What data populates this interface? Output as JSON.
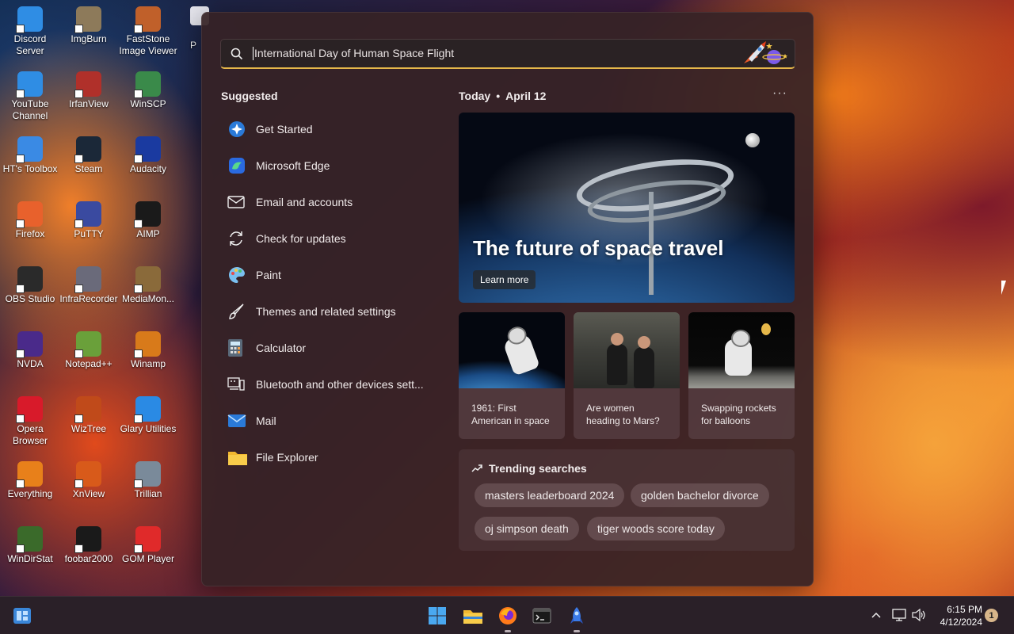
{
  "desktop": {
    "icons": [
      {
        "label": "Discord Server",
        "icon": "chrome-icon",
        "color": "#2f8de4"
      },
      {
        "label": "ImgBurn",
        "icon": "disc-icon",
        "color": "#8d7a5a"
      },
      {
        "label": "FastStone Image Viewer",
        "icon": "eye-icon",
        "color": "#c0602a"
      },
      {
        "label": "YouTube Channel",
        "icon": "chrome-icon",
        "color": "#2f8de4"
      },
      {
        "label": "IrfanView",
        "icon": "cat-icon",
        "color": "#b0302a"
      },
      {
        "label": "WinSCP",
        "icon": "computers-icon",
        "color": "#3a8a4a"
      },
      {
        "label": "HT's Toolbox",
        "icon": "folder-icon",
        "color": "#3a8ae4"
      },
      {
        "label": "Steam",
        "icon": "steam-icon",
        "color": "#1b2838"
      },
      {
        "label": "Audacity",
        "icon": "headphones-icon",
        "color": "#1a3aa0"
      },
      {
        "label": "Firefox",
        "icon": "firefox-icon",
        "color": "#e8612c"
      },
      {
        "label": "PuTTY",
        "icon": "terminal-icon",
        "color": "#3a4aa0"
      },
      {
        "label": "AIMP",
        "icon": "aimp-icon",
        "color": "#1a1a1a"
      },
      {
        "label": "OBS Studio",
        "icon": "obs-icon",
        "color": "#2a2a2a"
      },
      {
        "label": "InfraRecorder",
        "icon": "disc-icon",
        "color": "#6a6a7a"
      },
      {
        "label": "MediaMon...",
        "icon": "media-monkey-icon",
        "color": "#8a6a3a"
      },
      {
        "label": "NVDA",
        "icon": "nvda-icon",
        "color": "#4a2a8a"
      },
      {
        "label": "Notepad++",
        "icon": "notepad-icon",
        "color": "#6aa03a"
      },
      {
        "label": "Winamp",
        "icon": "winamp-icon",
        "color": "#d87a1a"
      },
      {
        "label": "Opera Browser",
        "icon": "opera-icon",
        "color": "#d81a2a"
      },
      {
        "label": "WizTree",
        "icon": "wiztree-icon",
        "color": "#c04a1a"
      },
      {
        "label": "Glary Utilities",
        "icon": "glary-icon",
        "color": "#2a8ae4"
      },
      {
        "label": "Everything",
        "icon": "search-icon",
        "color": "#e8801a"
      },
      {
        "label": "XnView",
        "icon": "xnview-icon",
        "color": "#d85a1a"
      },
      {
        "label": "Trillian",
        "icon": "trillian-icon",
        "color": "#7a8a9a"
      },
      {
        "label": "WinDirStat",
        "icon": "tree-icon",
        "color": "#3a6a2a"
      },
      {
        "label": "foobar2000",
        "icon": "foobar-icon",
        "color": "#1a1a1a"
      },
      {
        "label": "GOM Player",
        "icon": "gom-icon",
        "color": "#e02a2a"
      }
    ],
    "partial_label": "P"
  },
  "search": {
    "query": "International Day of Human Space Flight"
  },
  "suggested": {
    "title": "Suggested",
    "items": [
      {
        "label": "Get Started",
        "icon": "get-started-icon"
      },
      {
        "label": "Microsoft Edge",
        "icon": "edge-icon"
      },
      {
        "label": "Email and accounts",
        "icon": "mail-outline-icon"
      },
      {
        "label": "Check for updates",
        "icon": "refresh-icon"
      },
      {
        "label": "Paint",
        "icon": "paint-icon"
      },
      {
        "label": "Themes and related settings",
        "icon": "brush-icon"
      },
      {
        "label": "Calculator",
        "icon": "calculator-icon"
      },
      {
        "label": "Bluetooth and other devices sett...",
        "icon": "devices-icon"
      },
      {
        "label": "Mail",
        "icon": "mail-icon"
      },
      {
        "label": "File Explorer",
        "icon": "folder-icon"
      }
    ]
  },
  "today": {
    "label": "Today",
    "date": "April 12",
    "more": "···"
  },
  "hero": {
    "title": "The future of space travel",
    "button": "Learn more"
  },
  "cards": [
    {
      "text": "1961: First American in space"
    },
    {
      "text": "Are women heading to Mars?"
    },
    {
      "text": "Swapping rockets for balloons"
    }
  ],
  "trending": {
    "title": "Trending searches",
    "chips": [
      "masters leaderboard 2024",
      "golden bachelor divorce",
      "oj simpson death",
      "tiger woods score today"
    ]
  },
  "taskbar": {
    "apps": [
      {
        "name": "start-button",
        "icon": "windows-icon"
      },
      {
        "name": "file-explorer",
        "icon": "folder-icon"
      },
      {
        "name": "firefox",
        "icon": "firefox-icon"
      },
      {
        "name": "terminal",
        "icon": "terminal-icon"
      },
      {
        "name": "app-launcher",
        "icon": "rocket-icon"
      }
    ],
    "time": "6:15 PM",
    "date": "4/12/2024",
    "notification_count": "1"
  },
  "colors": {
    "accent": "#e6b84a",
    "panel": "#362226"
  }
}
